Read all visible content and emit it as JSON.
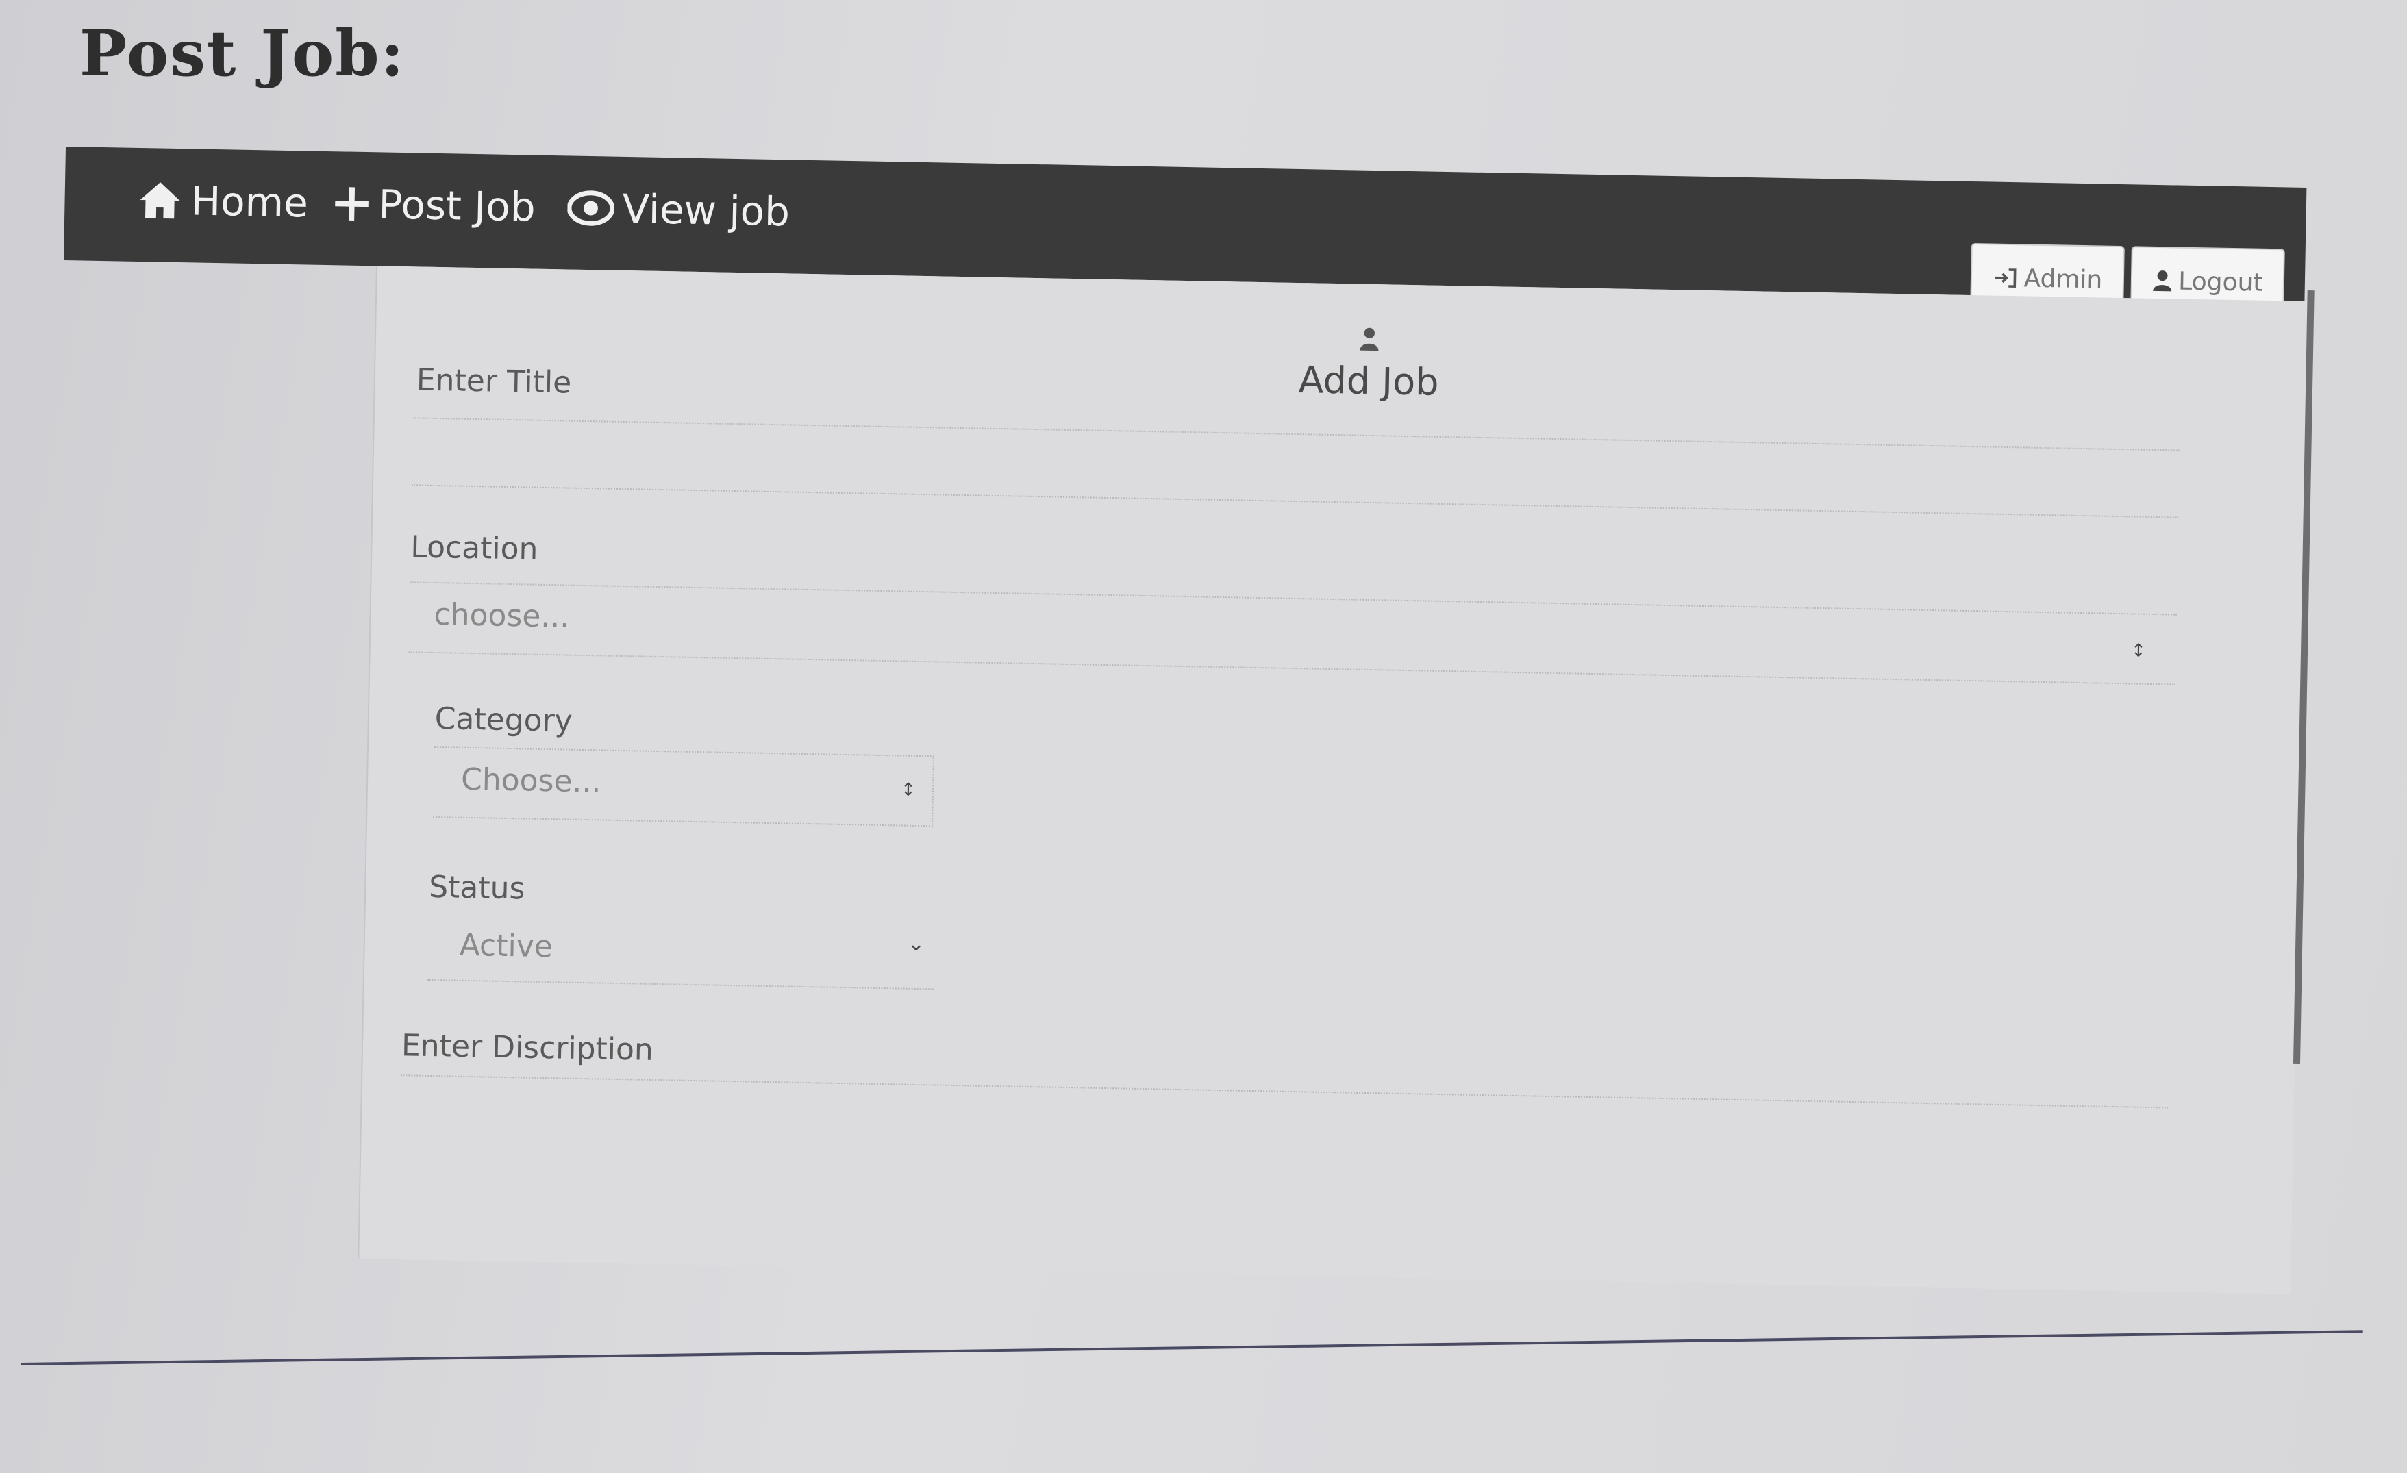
{
  "document": {
    "heading": "Post Job:"
  },
  "navbar": {
    "items": [
      {
        "label": "Home",
        "icon": "home-icon"
      },
      {
        "label": "Post Job",
        "icon": "plus-icon"
      },
      {
        "label": "View job",
        "icon": "eye-icon"
      }
    ],
    "buttons": {
      "admin": {
        "label": "Admin",
        "icon": "sign-in-icon"
      },
      "logout": {
        "label": "Logout",
        "icon": "user-icon"
      }
    },
    "background": "#3a3a3b"
  },
  "form": {
    "title": "Add Job",
    "title_icon": "user-icon",
    "fields": {
      "title": {
        "label": "Enter Title",
        "value": ""
      },
      "location": {
        "label": "Location",
        "placeholder": "choose..."
      },
      "category": {
        "label": "Category",
        "placeholder": "Choose..."
      },
      "status": {
        "label": "Status",
        "value": "Active"
      },
      "description": {
        "label": "Enter Discription",
        "value": ""
      }
    }
  }
}
